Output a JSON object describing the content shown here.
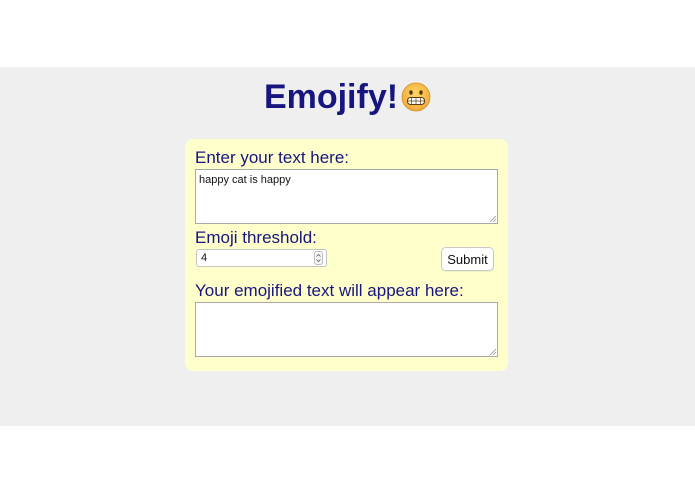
{
  "app": {
    "title": "Emojify!",
    "title_emoji_icon": "grinning-face-icon"
  },
  "form": {
    "input_label": "Enter your text here:",
    "input_value": "happy cat is happy",
    "threshold_label": "Emoji threshold:",
    "threshold_value": "4",
    "submit_label": "Submit",
    "output_label": "Your emojified text will appear here:",
    "output_value": ""
  },
  "colors": {
    "band_background": "#efefef",
    "panel_background": "#ffffcc",
    "text_primary": "#16167e"
  }
}
